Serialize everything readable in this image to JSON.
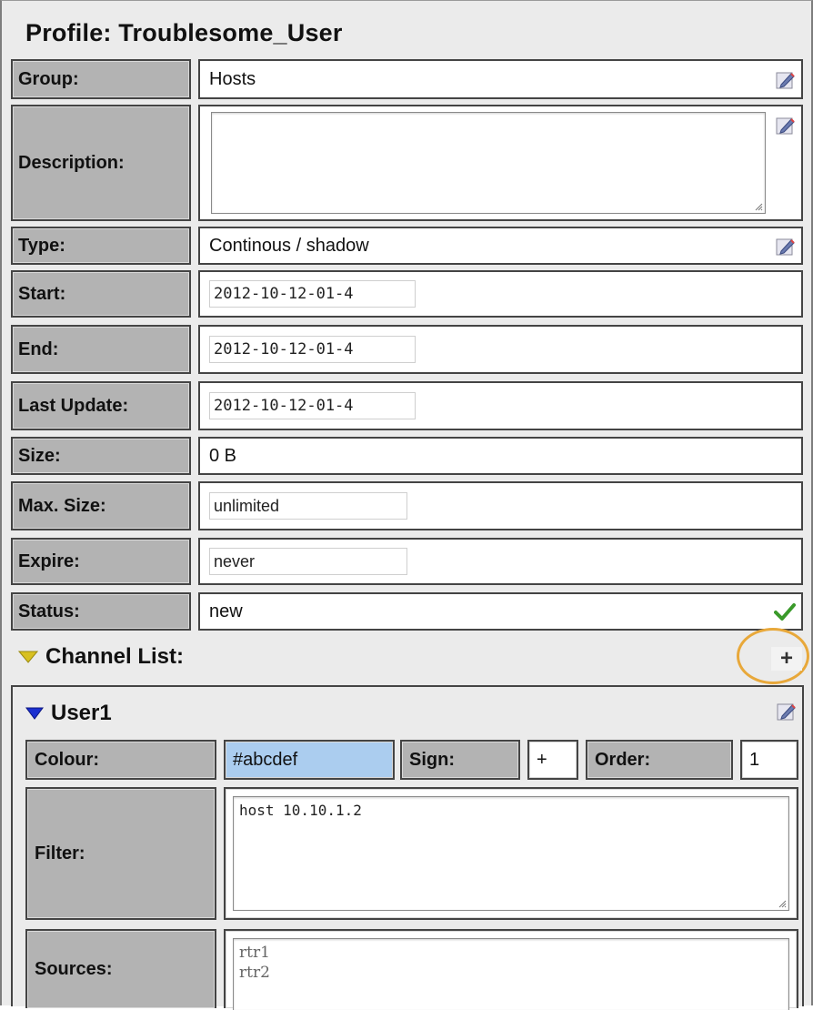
{
  "profile": {
    "title": "Profile:  Troublesome_User",
    "fields": {
      "group": {
        "label": "Group:",
        "value": "Hosts"
      },
      "description": {
        "label": "Description:",
        "value": ""
      },
      "type": {
        "label": "Type:",
        "value": "Continous / shadow"
      },
      "start": {
        "label": "Start:",
        "value": "2012-10-12-01-4"
      },
      "end": {
        "label": "End:",
        "value": "2012-10-12-01-4"
      },
      "last_update": {
        "label": "Last Update:",
        "value": "2012-10-12-01-4"
      },
      "size": {
        "label": "Size:",
        "value": "0 B"
      },
      "max_size": {
        "label": "Max. Size:",
        "value": "unlimited"
      },
      "expire": {
        "label": "Expire:",
        "value": "never"
      },
      "status": {
        "label": "Status:",
        "value": "new"
      }
    }
  },
  "channel_list": {
    "title": "Channel List:",
    "add_label": "+",
    "channel": {
      "name": "User1",
      "colour": {
        "label": "Colour:",
        "value": "#abcdef"
      },
      "sign": {
        "label": "Sign:",
        "value": "+"
      },
      "order": {
        "label": "Order:",
        "value": "1"
      },
      "filter": {
        "label": "Filter:",
        "value": "host 10.10.1.2"
      },
      "sources": {
        "label": "Sources:",
        "items": [
          "rtr1",
          "rtr2"
        ]
      }
    }
  },
  "colors": {
    "label_bg": "#b3b3b3",
    "colour_swatch": "#abcdef",
    "highlight_ring": "#e8a83a",
    "check_green": "#3a9a2a",
    "triangle_blue": "#1a2fd0",
    "triangle_yellow": "#d8c020"
  },
  "icons": {
    "edit": "edit-pencil-icon",
    "status_ok": "checkmark-icon",
    "expand": "triangle-down-icon"
  }
}
